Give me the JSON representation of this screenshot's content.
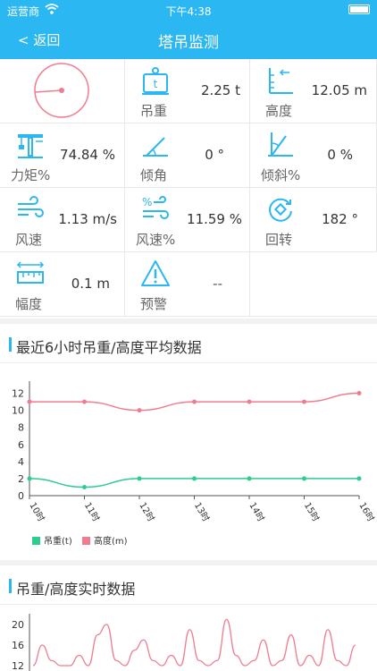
{
  "status": {
    "carrier": "运营商",
    "time": "下午4:38"
  },
  "nav": {
    "back_label": "< 返回",
    "title": "塔吊监测"
  },
  "metrics": [
    {
      "label": "吊重",
      "value": "2.25 t",
      "icon": "weight-icon"
    },
    {
      "label": "高度",
      "value": "12.05 m",
      "icon": "height-icon"
    },
    {
      "label": "力矩%",
      "value": "74.84 %",
      "icon": "crane-moment-icon"
    },
    {
      "label": "倾角",
      "value": "0 °",
      "icon": "angle-icon"
    },
    {
      "label": "倾斜%",
      "value": "0 %",
      "icon": "tilt-icon"
    },
    {
      "label": "风速",
      "value": "1.13 m/s",
      "icon": "wind-icon"
    },
    {
      "label": "风速%",
      "value": "11.59 %",
      "icon": "wind-percent-icon"
    },
    {
      "label": "回转",
      "value": "182 °",
      "icon": "rotate-icon"
    },
    {
      "label": "幅度",
      "value": "0.1 m",
      "icon": "ruler-icon"
    },
    {
      "label": "预警",
      "value": "--",
      "icon": "warning-icon"
    }
  ],
  "section1": {
    "title": "最近6小时吊重/高度平均数据"
  },
  "section2": {
    "title": "吊重/高度实时数据"
  },
  "colors": {
    "accent": "#2ab7f2",
    "weight": "#2ecc8f",
    "height": "#ef7d8f"
  },
  "chart_data": [
    {
      "type": "line",
      "categories": [
        "10时",
        "11时",
        "12时",
        "13时",
        "14时",
        "15时",
        "16时"
      ],
      "series": [
        {
          "name": "吊重(t)",
          "values": [
            2,
            1,
            2,
            2,
            2,
            2,
            2
          ]
        },
        {
          "name": "高度(m)",
          "values": [
            11,
            11,
            10,
            11,
            11,
            11,
            12
          ]
        }
      ],
      "ylim": [
        0,
        13
      ],
      "yticks": [
        0,
        2,
        4,
        6,
        8,
        10,
        12
      ],
      "grid": false,
      "legend": "bottom-left"
    },
    {
      "type": "line",
      "yticks_visible": [
        12,
        16,
        20
      ],
      "series": [
        {
          "name": "高度(m)",
          "values": [
            12,
            16,
            13,
            12,
            12,
            14,
            12,
            18,
            20,
            13,
            12,
            15,
            17,
            13,
            12,
            14,
            12,
            19,
            13,
            12,
            13,
            21,
            14,
            12,
            13,
            17,
            12,
            13,
            18,
            12,
            14,
            12,
            19,
            13,
            12,
            16
          ]
        }
      ],
      "ylim": [
        10,
        22
      ]
    }
  ]
}
